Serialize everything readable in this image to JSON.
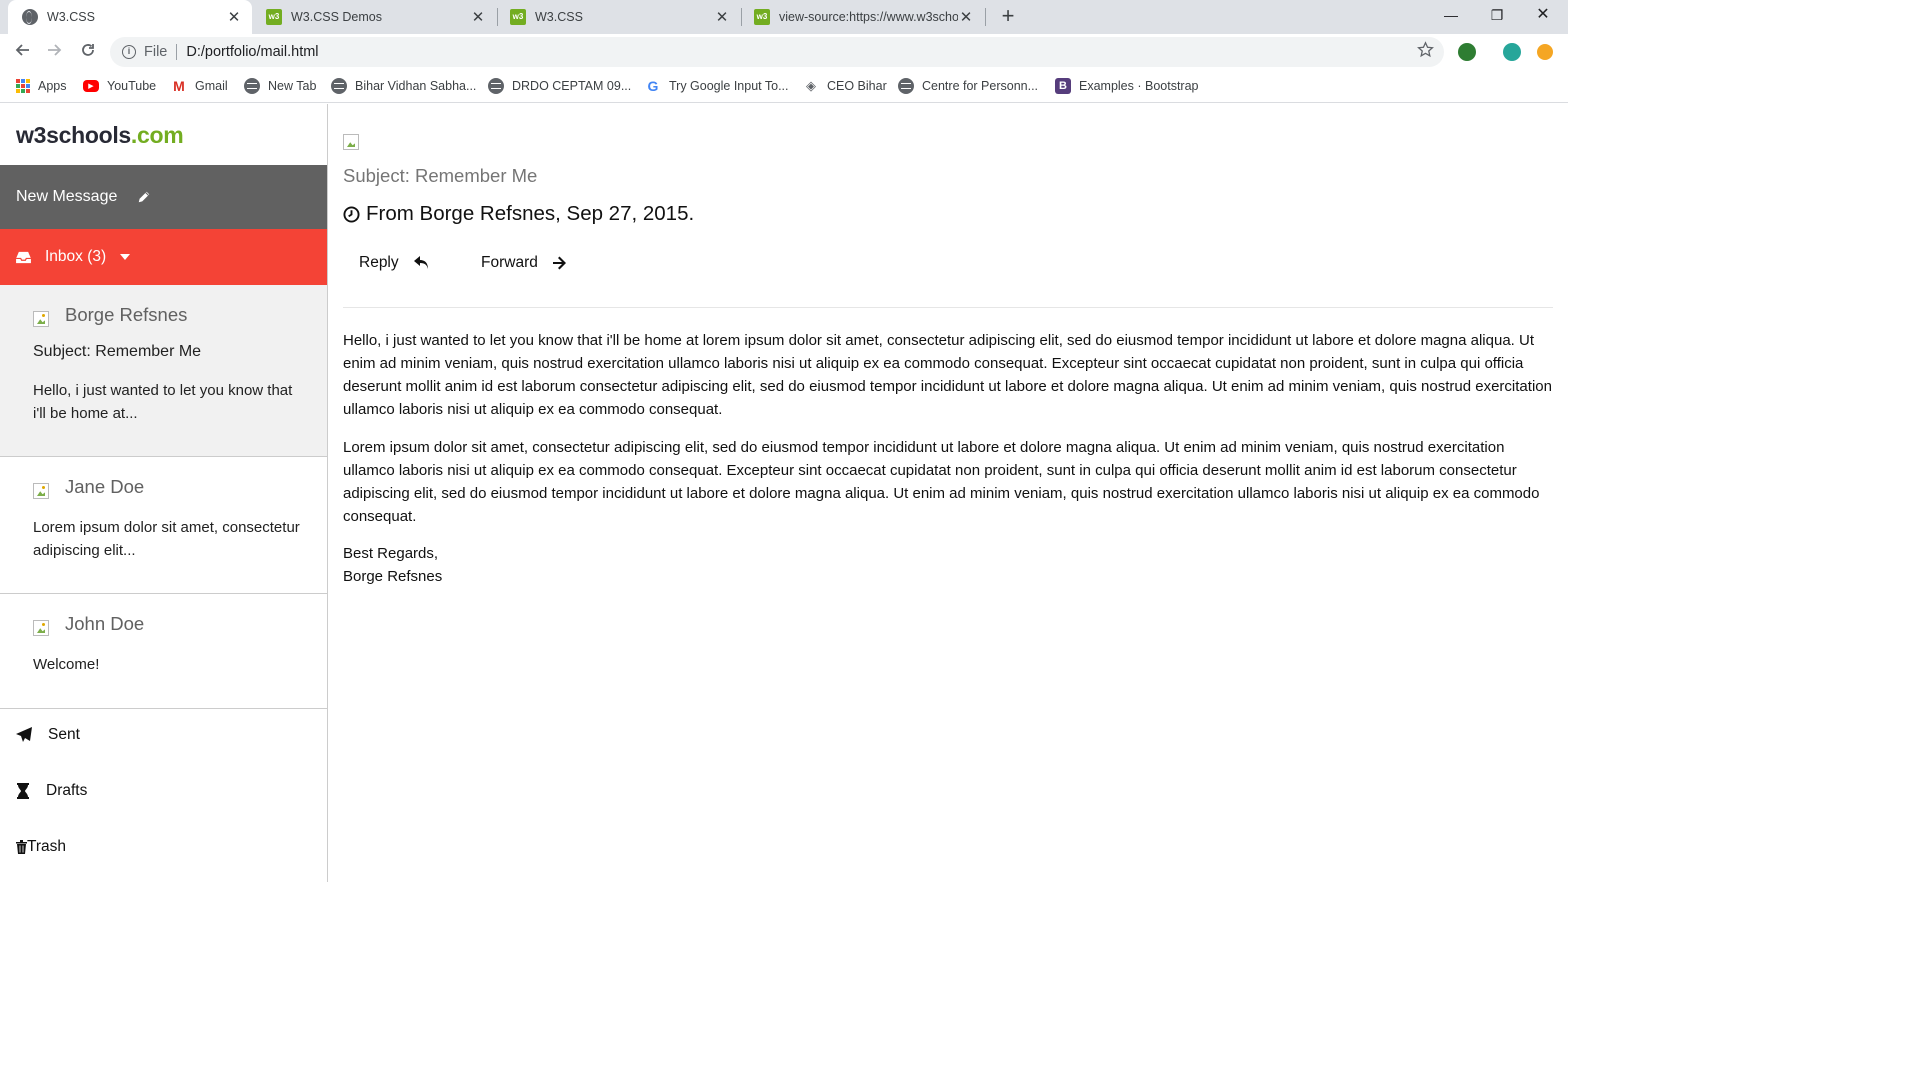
{
  "browser": {
    "tabs": [
      {
        "title": "W3.CSS",
        "favicon": "globe-icon",
        "active": true
      },
      {
        "title": "W3.CSS Demos",
        "favicon": "w3schools-icon",
        "active": false
      },
      {
        "title": "W3.CSS",
        "favicon": "w3schools-icon",
        "active": false
      },
      {
        "title": "view-source:https://www.w3schoo",
        "favicon": "w3schools-icon",
        "active": false
      }
    ],
    "favicon_text": "w3",
    "close_glyph": "✕",
    "new_tab_glyph": "+",
    "window_controls": {
      "minimize": "—",
      "maximize": "❐",
      "close": "✕"
    },
    "address": {
      "scheme": "File",
      "url": "D:/portfolio/mail.html"
    },
    "bookmarks": [
      {
        "label": "Apps",
        "icon": "apps-grid-icon"
      },
      {
        "label": "YouTube",
        "icon": "youtube-icon"
      },
      {
        "label": "Gmail",
        "icon": "gmail-icon"
      },
      {
        "label": "New Tab",
        "icon": "globe-icon"
      },
      {
        "label": "Bihar Vidhan Sabha...",
        "icon": "globe-icon"
      },
      {
        "label": "DRDO CEPTAM 09...",
        "icon": "globe-icon"
      },
      {
        "label": "Try Google Input To...",
        "icon": "google-icon"
      },
      {
        "label": "CEO Bihar",
        "icon": "ceo-icon"
      },
      {
        "label": "Centre for Personn...",
        "icon": "globe-icon"
      },
      {
        "label": "Examples · Bootstrap",
        "icon": "bootstrap-icon"
      }
    ],
    "bookmark_glyphs": {
      "youtube": "▶",
      "gmail": "M",
      "google": "G",
      "ceo": "◈",
      "bootstrap": "B"
    }
  },
  "sidebar": {
    "logo_main": "w3schools",
    "logo_suffix": ".com",
    "new_message": "New Message",
    "inbox": "Inbox (3)",
    "mails": [
      {
        "sender": "Borge Refsnes",
        "subject": "Subject: Remember Me",
        "preview": "Hello, i just wanted to let you know that i'll be home at..."
      },
      {
        "sender": "Jane Doe",
        "subject": "",
        "preview": "Lorem ipsum dolor sit amet, consectetur adipiscing elit..."
      },
      {
        "sender": "John Doe",
        "subject": "",
        "preview": "Welcome!"
      }
    ],
    "nav": [
      {
        "label": "Sent",
        "icon": "paper-plane-icon"
      },
      {
        "label": "Drafts",
        "icon": "hourglass-icon"
      },
      {
        "label": "Trash",
        "icon": "trash-icon"
      }
    ]
  },
  "message": {
    "subject": "Subject: Remember Me",
    "from": "From Borge Refsnes, Sep 27, 2015.",
    "reply": "Reply",
    "forward": "Forward",
    "paragraphs": [
      "Hello, i just wanted to let you know that i'll be home at lorem ipsum dolor sit amet, consectetur adipiscing elit, sed do eiusmod tempor incididunt ut labore et dolore magna aliqua. Ut enim ad minim veniam, quis nostrud exercitation ullamco laboris nisi ut aliquip ex ea commodo consequat. Excepteur sint occaecat cupidatat non proident, sunt in culpa qui officia deserunt mollit anim id est laborum consectetur adipiscing elit, sed do eiusmod tempor incididunt ut labore et dolore magna aliqua. Ut enim ad minim veniam, quis nostrud exercitation ullamco laboris nisi ut aliquip ex ea commodo consequat.",
      "Lorem ipsum dolor sit amet, consectetur adipiscing elit, sed do eiusmod tempor incididunt ut labore et dolore magna aliqua. Ut enim ad minim veniam, quis nostrud exercitation ullamco laboris nisi ut aliquip ex ea commodo consequat. Excepteur sint occaecat cupidatat non proident, sunt in culpa qui officia deserunt mollit anim id est laborum consectetur adipiscing elit, sed do eiusmod tempor incididunt ut labore et dolore magna aliqua. Ut enim ad minim veniam, quis nostrud exercitation ullamco laboris nisi ut aliquip ex ea commodo consequat."
    ],
    "signoff": "Best Regards,",
    "signature": "Borge Refsnes"
  },
  "colors": {
    "inbox_red": "#f44336",
    "new_message_gray": "#616161",
    "logo_green": "#73ad21",
    "selected_mail_bg": "#f1f1f1"
  }
}
